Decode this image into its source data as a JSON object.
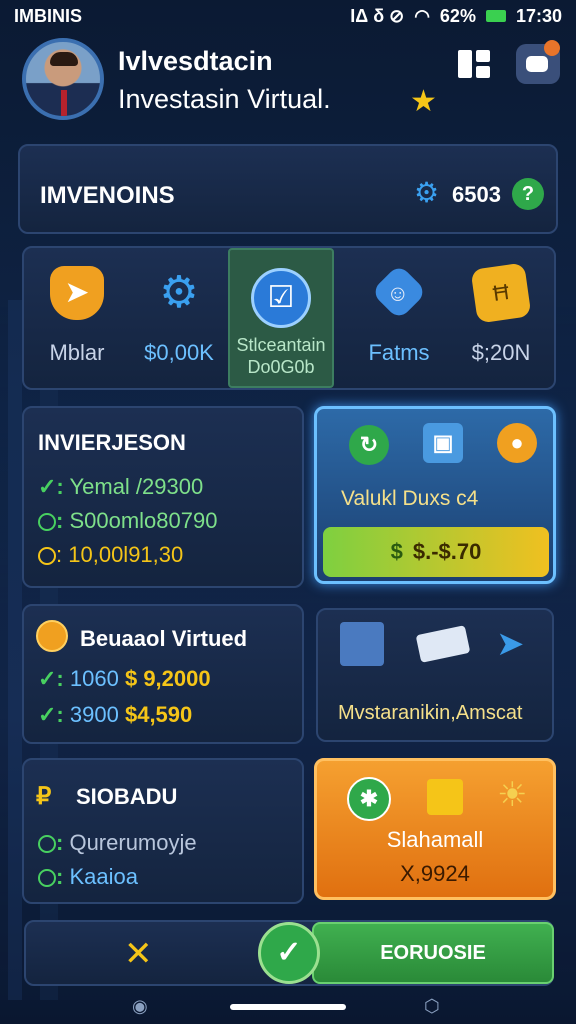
{
  "status_bar": {
    "carrier": "IMBINIS",
    "indicators": "ΙΔ δ ⊘",
    "battery": "62%",
    "time": "17:30"
  },
  "header": {
    "title_line1": "Ivlvesdtacin",
    "title_line2": "Investasin Virtual."
  },
  "investments_panel": {
    "label": "IMVENOINS",
    "value": "6503"
  },
  "categories": [
    {
      "label": "Mblar",
      "icon": "shield-icon",
      "color": "#f0a020"
    },
    {
      "label": "$0,00K",
      "icon": "gear-icon",
      "color": "#3aa0f0"
    },
    {
      "label_line1": "Stlceantain",
      "label_line2": "Do0G0b",
      "icon": "checklist-icon",
      "color": "#3aa0f0",
      "selected": true
    },
    {
      "label": "Fatms",
      "icon": "user-badge-icon",
      "color": "#3a8ae0"
    },
    {
      "label": "$;20N",
      "icon": "ticket-icon",
      "color": "#f0b020"
    }
  ],
  "section1": {
    "title": "INVIERJESON",
    "rows": [
      {
        "marker": "✓:",
        "text": "Yemal /29300"
      },
      {
        "marker": ":",
        "text": "S00omlo80790"
      },
      {
        "marker": ":",
        "text": "10,00l91,30"
      }
    ],
    "card": {
      "text": "Valukl Duxs c4",
      "button_amount": "$.-$.70"
    }
  },
  "section2": {
    "title": "Beuaaol Virtued",
    "rows": [
      {
        "marker": "✓:",
        "num": "1060",
        "amount": "$ 9,2000"
      },
      {
        "marker": "✓:",
        "num": "3900",
        "amount": "$4,590"
      }
    ],
    "card": {
      "text": "Mvstaranikin,Amscat"
    }
  },
  "section3": {
    "title": "SIOBADU",
    "rows": [
      {
        "marker": ":",
        "text": "Qurerumoyje"
      },
      {
        "marker": ":",
        "text": "Kaaioa"
      }
    ],
    "card": {
      "title": "Slahamall",
      "value": "X,9924"
    }
  },
  "bottom_bar": {
    "button_label": "EORUOSIE"
  }
}
